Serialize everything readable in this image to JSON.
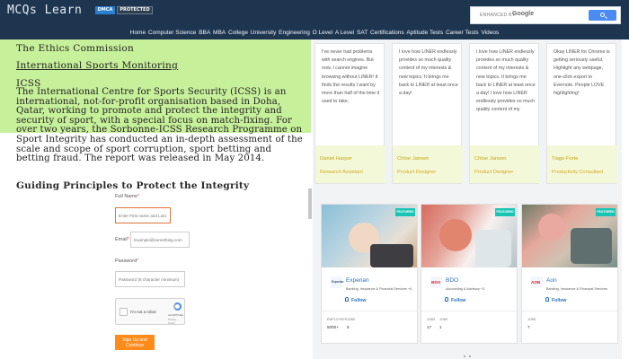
{
  "header": {
    "site_title": "MCQs Learn",
    "badges": [
      "DMCA",
      "PROTECTED"
    ],
    "search": {
      "label": "ENHANCED BY",
      "brand": "Google"
    },
    "nav_links": [
      "Home",
      "Computer Science",
      "BBA",
      "MBA",
      "College",
      "University",
      "Engineering",
      "O Level",
      "A Level",
      "SAT",
      "Certifications",
      "Aptitude Tests",
      "Career Tests",
      "Videos"
    ]
  },
  "article": {
    "headings": [
      "The Ethics Commission",
      "International Sports Monitoring",
      "ICSS"
    ],
    "body": "The International Centre for Sports Security (ICSS) is an international, not-for-profit organisation based in Doha, Qatar, working to promote and protect the integrity and security of sport, with a special focus on match-fixing. For over two years, the Sorbonne-ICSS Research Programme on Sport Integrity has conducted an in-depth assessment of the scale and scope of sport corruption, sport betting and betting fraud. The report was released in May 2014.",
    "guiding_heading": "Guiding Principles to Protect the Integrity"
  },
  "form": {
    "name_label": "Full Name",
    "name_placeholder": "Enter First name and Last Name",
    "email_label": "Email",
    "email_placeholder": "Example@something.com",
    "password_label": "Password",
    "password_placeholder": "Password (8 character minimum)",
    "recaptcha_text": "I'm not a robot",
    "recaptcha_brand": "reCAPTCHA",
    "recaptcha_terms": "Privacy - Terms",
    "submit_label": "Sign Up and Continue"
  },
  "testimonials": [
    {
      "quote": "I've never had problems with search engines. But now, I cannot imagine browsing without LINER! It finds the results I want by more than half of the time it used to take.",
      "name": "Daniel Harper",
      "role": "Research Assistant"
    },
    {
      "quote": "I love how LINER endlessly provides so much quality content of my interests & new topics. It brings me back to LINER at least once a day!",
      "name": "Chloe Jansen",
      "role": "Product Designer"
    },
    {
      "quote": "I love how LINER endlessly provides so much quality content of my interests & new topics. It brings me back to LINER at least once a day! I love how LINER endlessly provides so much quality content of my",
      "name": "Chloe Jansen",
      "role": "Product Designer"
    },
    {
      "quote": "Okay LINER for Chrome is getting seriously useful. Highlight any webpage, one-click export to Evernote. People LOVE highlighting!",
      "name": "Tiago Forte",
      "role": "Productivity Consultant"
    }
  ],
  "companies": [
    {
      "featured": "FEATURED",
      "logo": "Experian",
      "name": "Experian",
      "sector": "Banking, Insurance & Financial Services +4",
      "follow": "Follow",
      "stat1_label": "EMPLOYEES",
      "stat1_value": "5000+",
      "stat2_label": "JOBS",
      "stat2_value": "5"
    },
    {
      "featured": "FEATURED",
      "logo": "BDO",
      "name": "BDO",
      "sector": "Accounting & Advisory +3",
      "follow": "Follow",
      "stat1_label": "JOBS",
      "stat1_value": "17",
      "stat2_label": "JOBS",
      "stat2_value": "1"
    },
    {
      "featured": "FEATURED",
      "logo": "AON",
      "name": "Aon",
      "sector": "Banking, Insurance & Financial Services",
      "follow": "Follow",
      "stat1_label": "JOBS",
      "stat1_value": "7",
      "stat2_label": "",
      "stat2_value": ""
    }
  ],
  "colors": {
    "header_bg": "#1e3550",
    "highlight": "#c7f09b",
    "accent": "#ff8c1a",
    "link": "#2a6fc0",
    "featured": "#19c4b4"
  }
}
